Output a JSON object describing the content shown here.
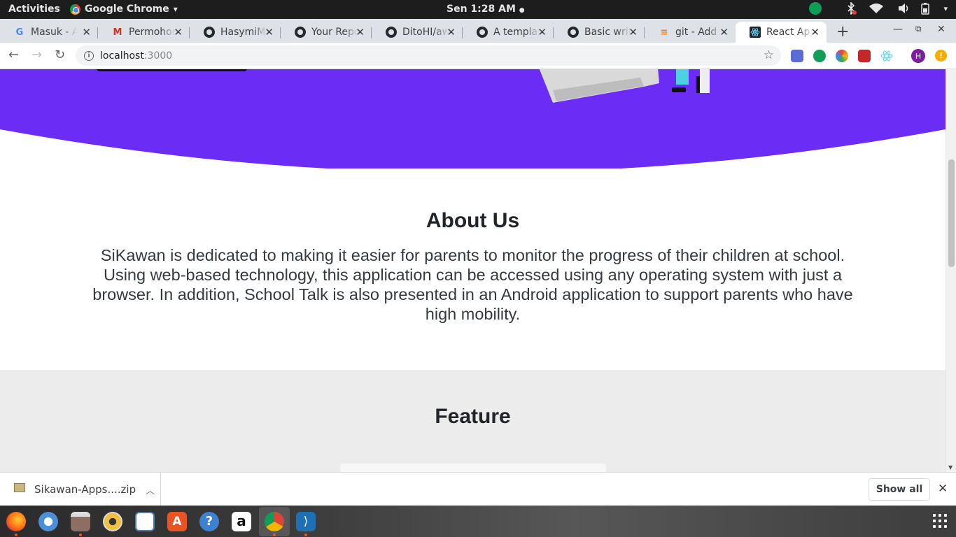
{
  "topbar": {
    "activities": "Activities",
    "app_name": "Google Chrome",
    "app_menu_arrow": "▾",
    "clock": "Sen  1:28 AM"
  },
  "tabs": [
    {
      "title": "Masuk - Akun",
      "icon": "google-icon"
    },
    {
      "title": "Permohonan",
      "icon": "gmail-icon"
    },
    {
      "title": "HasymiMuha",
      "icon": "github-icon"
    },
    {
      "title": "Your Repositories",
      "icon": "github-icon"
    },
    {
      "title": "DitoHI/awesome",
      "icon": "github-icon"
    },
    {
      "title": "A template",
      "icon": "github-icon"
    },
    {
      "title": "Basic writing",
      "icon": "github-icon"
    },
    {
      "title": "git - Add in",
      "icon": "stackoverflow-icon"
    },
    {
      "title": "React App",
      "icon": "react-icon",
      "active": true
    }
  ],
  "toolbar": {
    "url_host": "localhost",
    "url_port": ":3000",
    "profile_initial": "H",
    "update_badge": "!"
  },
  "page": {
    "about_title": "About Us",
    "about_text": "SiKawan is dedicated to making it easier for parents to monitor the progress of their children at school. Using web-based technology, this application can be accessed using any operating system with just a browser. In addition, School Talk is also presented in an Android application to support parents who have high mobility.",
    "feature_title": "Feature"
  },
  "downloads": {
    "file_name": "Sikawan-Apps....zip",
    "show_all": "Show all"
  },
  "colors": {
    "hero_purple": "#6b2cf5",
    "feature_bg": "#ececec",
    "topbar_bg": "#1d1d1d"
  }
}
